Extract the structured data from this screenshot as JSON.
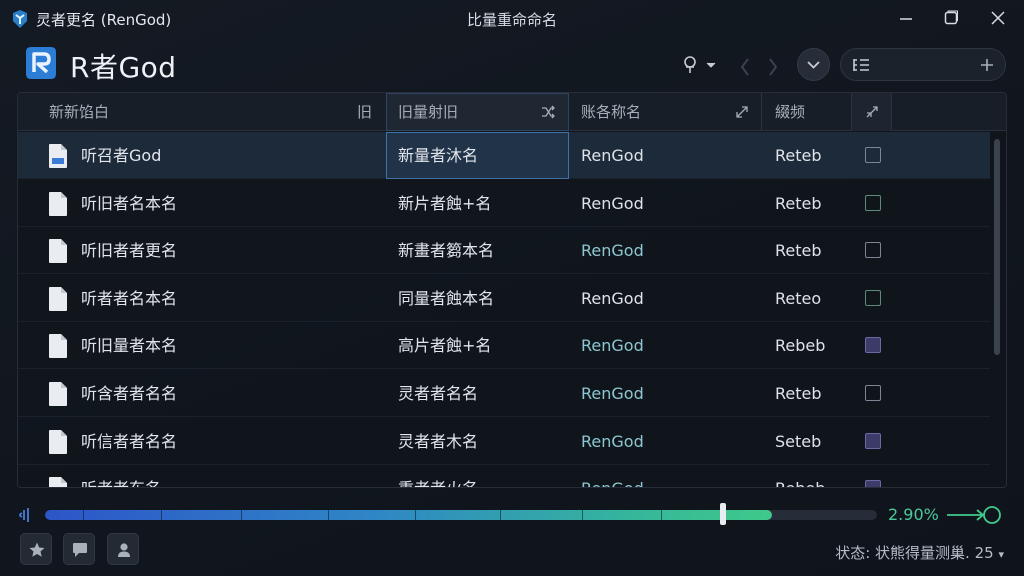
{
  "window": {
    "title": "灵者更名 (RenGod)",
    "center_title": "比量重命命名"
  },
  "app": {
    "name": "R者God"
  },
  "table": {
    "headers": [
      "新新馅白",
      "旧",
      "旧量射旧",
      "账各称名",
      "綴频"
    ],
    "rows": [
      {
        "name": "听召者God",
        "new_name": "新量者沐名",
        "ext": "RenGod",
        "status": "Reteb",
        "check": "empty",
        "selected": true,
        "teal": false
      },
      {
        "name": "听旧者名本名",
        "new_name": "新片者蝕+名",
        "ext": "RenGod",
        "status": "Reteb",
        "check": "green",
        "selected": false,
        "teal": false
      },
      {
        "name": "听旧者者更名",
        "new_name": "新畫者篘本名",
        "ext": "RenGod",
        "status": "Retеb",
        "check": "empty",
        "selected": false,
        "teal": true
      },
      {
        "name": "听者者名本名",
        "new_name": "同量者蝕本名",
        "ext": "RenGod",
        "status": "Reteo",
        "check": "green",
        "selected": false,
        "teal": false
      },
      {
        "name": "听旧量者本名",
        "new_name": "高片者蝕+名",
        "ext": "RenGod",
        "status": "Rebeb",
        "check": "purple",
        "selected": false,
        "teal": true
      },
      {
        "name": "听含者者名名",
        "new_name": "灵者者名名",
        "ext": "RenGod",
        "status": "Reteb",
        "check": "empty",
        "selected": false,
        "teal": true
      },
      {
        "name": "听信者者名名",
        "new_name": "灵者者木名",
        "ext": "RenGod",
        "status": "Seteb",
        "check": "purple",
        "selected": false,
        "teal": true
      },
      {
        "name": "听者者东名",
        "new_name": "重者者火名",
        "ext": "RenGod",
        "status": "Rebeb",
        "check": "purple",
        "selected": false,
        "teal": true
      }
    ]
  },
  "progress": {
    "value_fraction": 0.874,
    "percent_label": "2.90%"
  },
  "status_bar": {
    "text": "状态: 状熊得量测巢. 25"
  },
  "colors": {
    "accent": "#3fc98a",
    "selection": "#3f73a8",
    "background": "#11161e"
  },
  "icons": {
    "logo": "rengod-logo-icon",
    "header": [
      "pin-icon",
      "back-icon",
      "forward-icon",
      "chevron-down-icon",
      "list-icon",
      "add-icon"
    ],
    "footer": [
      "star-icon",
      "comment-icon",
      "user-icon"
    ]
  }
}
